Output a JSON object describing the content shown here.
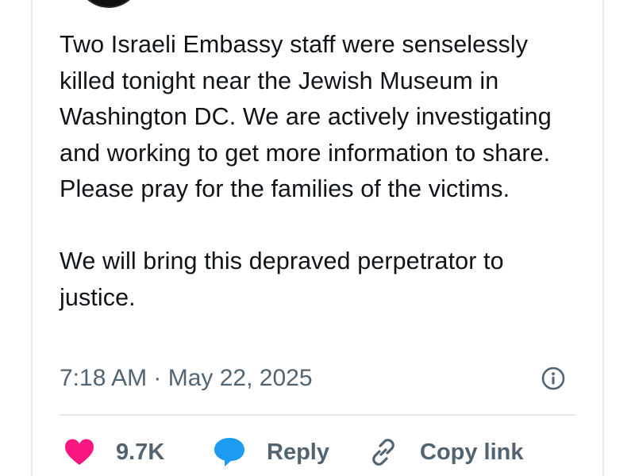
{
  "tweet": {
    "paragraphs": [
      "Two Israeli Embassy staff were senselessly killed tonight near the Jewish Museum in Washington DC. We are actively investigating and working to get more information to share. Please pray for the families of the victims.",
      "We will bring this depraved perpetrator to justice."
    ],
    "timestamp": "7:18 AM · May 22, 2025"
  },
  "actions": {
    "like_count": "9.7K",
    "reply_label": "Reply",
    "copy_label": "Copy link"
  },
  "icons": {
    "heart": "heart-icon",
    "reply": "speech-bubble-icon",
    "copy": "link-icon",
    "info": "info-icon"
  },
  "colors": {
    "text": "#0f1419",
    "secondary": "#536471",
    "like": "#f91880",
    "reply": "#1d9bf0",
    "divider": "#e3e8ec"
  }
}
